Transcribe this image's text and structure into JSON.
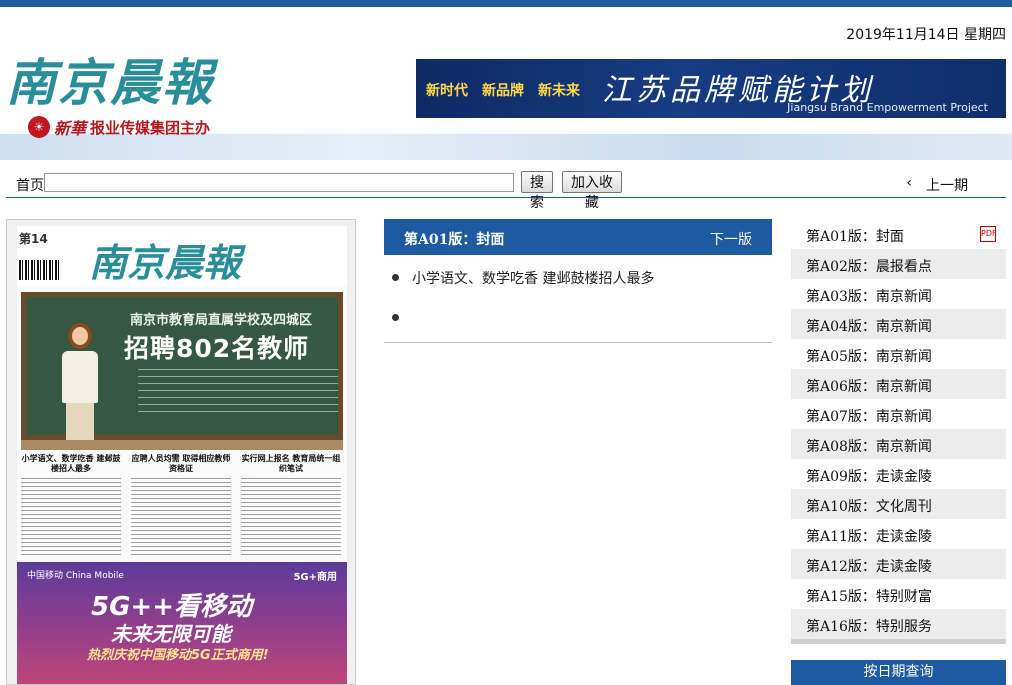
{
  "header": {
    "date": "2019年11月14日 星期四",
    "masthead": "南京晨報",
    "sponsor_brand": "新華",
    "sponsor_text": "报业传媒集团主办",
    "banner": {
      "tags": [
        "新时代",
        "新品牌",
        "新未来"
      ],
      "title": "江苏品牌赋能计划",
      "subtitle": "Jiangsu Brand Empowerment Project"
    }
  },
  "nav": {
    "home": "首页",
    "search_value": "",
    "search_button": "搜索",
    "favorite_button": "加入收藏",
    "prev_arrow": "‹",
    "prev_issue": "上一期"
  },
  "paper": {
    "issue_label": "第14",
    "masthead": "南京晨報",
    "board_top": "南京市教育局直属学校及四城区",
    "board_title": "招聘802名教师",
    "columns": [
      "小学语文、数学吃香 建邺鼓楼招人最多",
      "应聘人员均需 取得相应教师资格证",
      "实行网上报名 教育局统一组织笔试"
    ],
    "ad": {
      "logo": "中国移动 China Mobile",
      "tag": "5G+商用",
      "headline": "5G++看移动",
      "main": "未来无限可能",
      "sub": "热烈庆祝中国移动5G正式商用!"
    }
  },
  "current_page": {
    "title": "第A01版：封面",
    "next_label": "下一版",
    "articles": [
      "小学语文、数学吃香 建邺鼓楼招人最多",
      ""
    ]
  },
  "page_list": [
    "第A01版：封面",
    "第A02版：晨报看点",
    "第A03版：南京新闻",
    "第A04版：南京新闻",
    "第A05版：南京新闻",
    "第A06版：南京新闻",
    "第A07版：南京新闻",
    "第A08版：南京新闻",
    "第A09版：走读金陵",
    "第A10版：文化周刊",
    "第A11版：走读金陵",
    "第A12版：走读金陵",
    "第A15版：特别财富",
    "第A16版：特别服务"
  ],
  "pdf_icon_text": "PDF",
  "date_query_label": "按日期查询",
  "colors": {
    "accent": "#1e5aa0",
    "masthead": "#2a8e9a",
    "sponsor": "#b3181f"
  }
}
